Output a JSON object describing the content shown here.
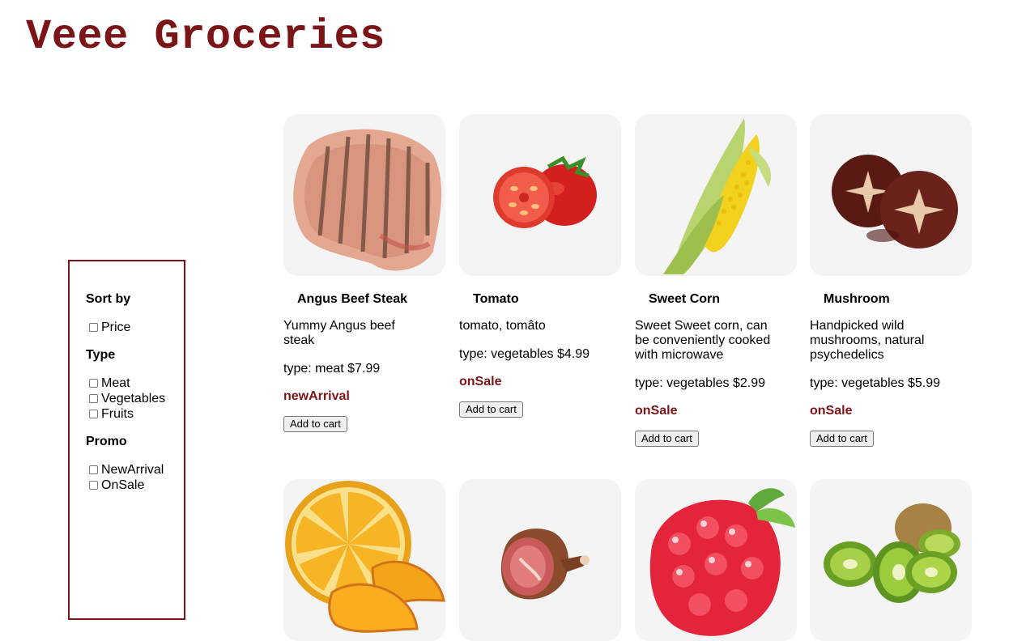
{
  "site": {
    "title": "Veee Groceries"
  },
  "filters": {
    "sort_heading": "Sort by",
    "sort_options": [
      "Price"
    ],
    "type_heading": "Type",
    "type_options": [
      "Meat",
      "Vegetables",
      "Fruits"
    ],
    "promo_heading": "Promo",
    "promo_options": [
      "NewArrival",
      "OnSale"
    ]
  },
  "products": [
    {
      "name": "Angus Beef Steak",
      "desc": "Yummy Angus beef steak",
      "meta": "type: meat $7.99",
      "promo": "newArrival",
      "button": "Add to cart",
      "image_icon": "steak-icon"
    },
    {
      "name": "Tomato",
      "desc": "tomato, tomâto",
      "meta": "type: vegetables $4.99",
      "promo": "onSale",
      "button": "Add to cart",
      "image_icon": "tomato-icon"
    },
    {
      "name": "Sweet Corn",
      "desc": "Sweet Sweet corn, can be conveniently cooked with microwave",
      "meta": "type: vegetables $2.99",
      "promo": "onSale",
      "button": "Add to cart",
      "image_icon": "corn-icon"
    },
    {
      "name": "Mushroom",
      "desc": "Handpicked wild mushrooms, natural psychedelics",
      "meta": "type: vegetables $5.99",
      "promo": "onSale",
      "button": "Add to cart",
      "image_icon": "mushroom-icon"
    }
  ],
  "products_row2": [
    {
      "image_icon": "orange-icon"
    },
    {
      "image_icon": "ham-icon"
    },
    {
      "image_icon": "raspberry-icon"
    },
    {
      "image_icon": "kiwi-icon"
    }
  ],
  "colors": {
    "brand": "#7b1416",
    "card_bg": "#f4f4f4"
  }
}
